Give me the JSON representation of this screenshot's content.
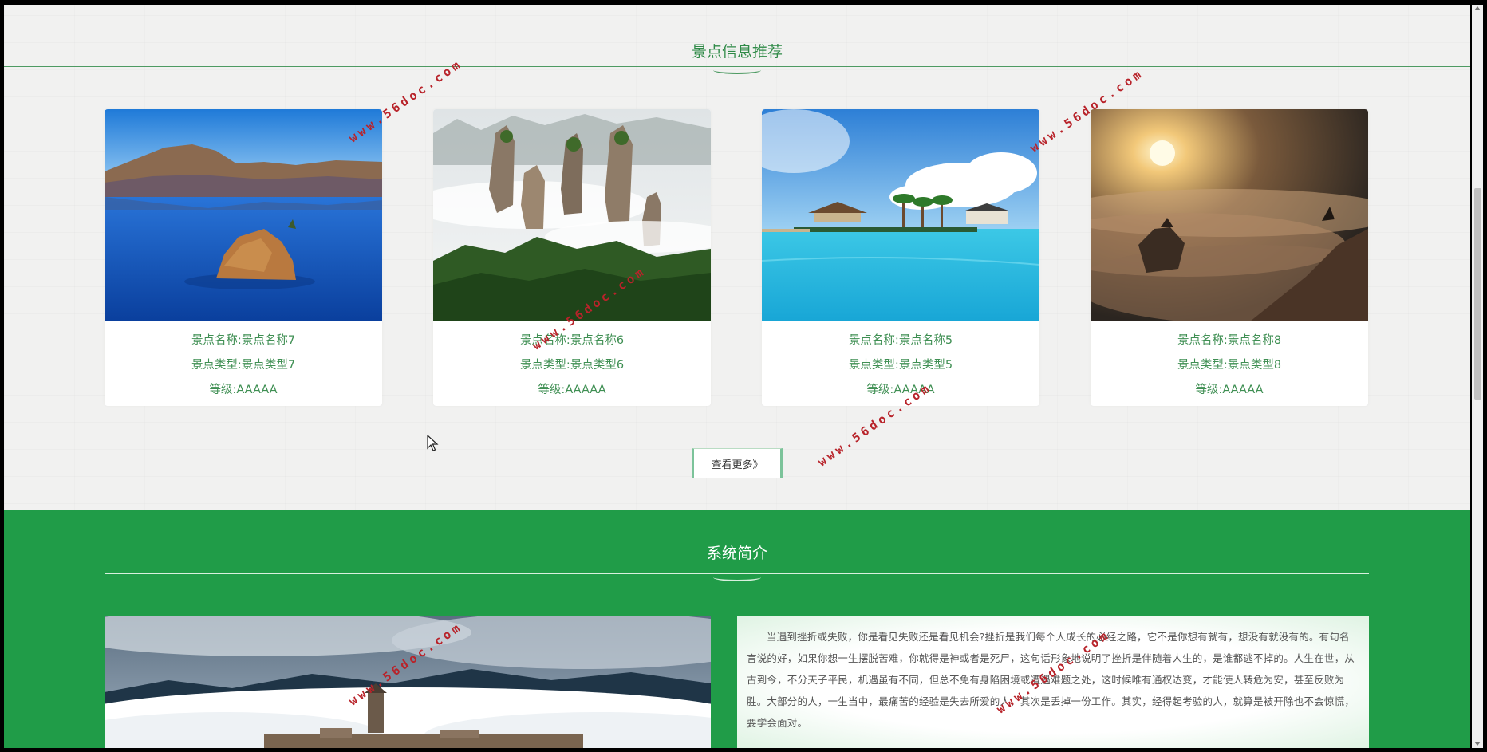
{
  "recommend": {
    "title": "景点信息推荐",
    "more_button": "查看更多》",
    "cards": [
      {
        "name": "景点名称:景点名称7",
        "type": "景点类型:景点类型7",
        "level": "等级:AAAAA"
      },
      {
        "name": "景点名称:景点名称6",
        "type": "景点类型:景点类型6",
        "level": "等级:AAAAA"
      },
      {
        "name": "景点名称:景点名称5",
        "type": "景点类型:景点类型5",
        "level": "等级:AAAAA"
      },
      {
        "name": "景点名称:景点名称8",
        "type": "景点类型:景点类型8",
        "level": "等级:AAAAA"
      }
    ]
  },
  "intro": {
    "title": "系统简介",
    "text": "当遇到挫折或失败，你是看见失败还是看见机会?挫折是我们每个人成长的必经之路，它不是你想有就有，想没有就没有的。有句名言说的好，如果你想一生摆脱苦难，你就得是神或者是死尸，这句话形象地说明了挫折是伴随着人生的，是谁都逃不掉的。人生在世，从古到今，不分天子平民，机遇虽有不同，但总不免有身陷困境或遭遇难题之处，这时候唯有通权达变，才能使人转危为安，甚至反败为胜。大部分的人，一生当中，最痛苦的经验是失去所爱的人，其次是丢掉一份工作。其实，经得起考验的人，就算是被开除也不会惊慌，要学会面对。"
  },
  "watermark": "www.56doc.com",
  "colors": {
    "accent_green": "#209c48",
    "text_green": "#3f8f53",
    "watermark_red": "#b8232a"
  }
}
